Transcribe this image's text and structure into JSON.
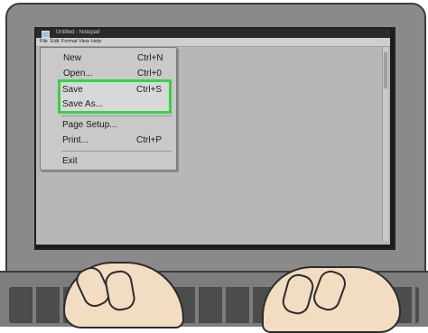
{
  "window": {
    "title": "Untitled - Notepad"
  },
  "menubar": {
    "items": [
      "File",
      "Edit",
      "Format",
      "View",
      "Help"
    ]
  },
  "file_menu": {
    "items": [
      {
        "label": "New",
        "shortcut": "Ctrl+N"
      },
      {
        "label": "Open...",
        "shortcut": "Ctrl+0"
      },
      {
        "label": "Save",
        "shortcut": "Ctrl+S"
      },
      {
        "label": "Save As...",
        "shortcut": ""
      },
      {
        "label": "Page Setup...",
        "shortcut": ""
      },
      {
        "label": "Print...",
        "shortcut": "Ctrl+P"
      },
      {
        "label": "Exit",
        "shortcut": ""
      }
    ]
  },
  "colors": {
    "highlight_border": "#35d24a"
  }
}
